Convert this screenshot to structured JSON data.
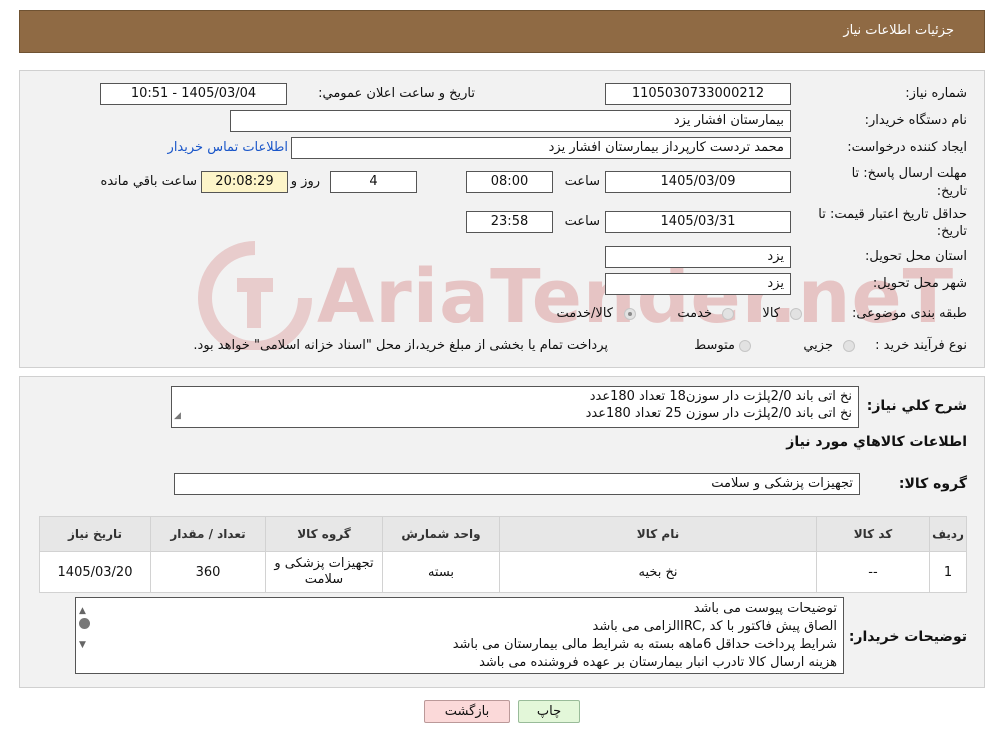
{
  "header": {
    "title": "جزئیات اطلاعات نیاز"
  },
  "watermark": {
    "text": "AriaTender.neT"
  },
  "form": {
    "need_number_label": "شماره نیاز:",
    "need_number": "1105030733000212",
    "announce_label": "تاریخ و ساعت اعلان عمومي:",
    "announce_value": "1405/03/04 - 10:51",
    "buyer_org_label": "نام دستگاه خريدار:",
    "buyer_org": "بیمارستان افشار یزد",
    "requester_label": "ايجاد كننده درخواست:",
    "requester": "محمد تردست کارپرداز بیمارستان افشار یزد",
    "contact_link": "اطلاعات تماس خريدار",
    "deadline_label_1": "مهلت ارسال پاسخ: تا",
    "deadline_label_2": "تاريخ:",
    "deadline_date": "1405/03/09",
    "time_label": "ساعت",
    "deadline_time": "08:00",
    "days_value": "4",
    "days_label": "روز و",
    "remaining_time": "20:08:29",
    "remaining_label": "ساعت باقي مانده",
    "validity_label_1": "حداقل تاريخ اعتبار قيمت: تا",
    "validity_label_2": "تاريخ:",
    "validity_date": "1405/03/31",
    "validity_time": "23:58",
    "province_label": "استان محل تحويل:",
    "province": "یزد",
    "city_label": "شهر محل تحويل:",
    "city": "یزد",
    "category_label": "طبقه بندی موضوعی:",
    "category_options": [
      "کالا",
      "خدمت",
      "کالا/خدمت"
    ],
    "process_label": "نوع فرآيند خريد :",
    "process_options": [
      "جزيي",
      "متوسط"
    ],
    "process_note": "پرداخت تمام یا بخشی از مبلغ خرید،از محل \"اسناد خزانه اسلامی\" خواهد بود."
  },
  "summary": {
    "label": "شرح كلي نياز:",
    "lines": [
      "نخ اتی باند 2/0پلژت دار سوزن18 تعداد 180عدد",
      "نخ اتی باند 2/0پلژت دار سوزن 25 تعداد 180عدد"
    ]
  },
  "goods": {
    "section_title": "اطلاعات كالاهاي مورد نياز",
    "group_label": "گروه کالا:",
    "group_value": "تجهیزات پزشکی و سلامت",
    "columns": [
      "رديف",
      "کد کالا",
      "نام کالا",
      "واحد شمارش",
      "گروه کالا",
      "تعداد / مقدار",
      "تاريخ نياز"
    ],
    "rows": [
      [
        "1",
        "--",
        "نخ بخیه",
        "بسته",
        "تجهیزات پزشکی و سلامت",
        "360",
        "1405/03/20"
      ]
    ]
  },
  "buyer_notes": {
    "label": "توضيحات خريدار:",
    "lines": [
      "توضیحات پیوست می باشد",
      "الصاق پیش فاکتور با کد  ,IRCالزامی می باشد",
      "شرایط پرداخت حداقل 6ماهه بسته به شرایط مالی بیمارستان می باشد",
      "هزینه ارسال کالا تادرب انبار بیمارستان بر عهده فروشنده می باشد"
    ]
  },
  "buttons": {
    "print": "چاپ",
    "back": "بازگشت"
  }
}
